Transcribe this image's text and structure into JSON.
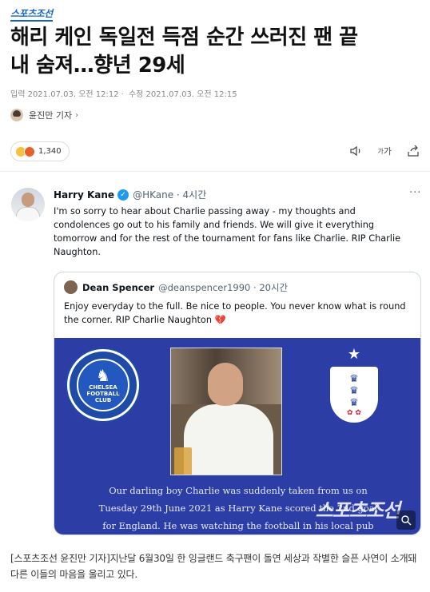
{
  "brand": {
    "logo_text": "스포츠조선"
  },
  "article": {
    "title_line1": "해리 케인 독일전 득점 순간 쓰러진 팬 끝",
    "title_line2": "내 숨져…향년 29세",
    "published": "입력 2021.07.03. 오전 12:12",
    "modified": "수정 2021.07.03. 오전 12:15",
    "reporter": "윤진만 기자",
    "reaction_count": "1,340",
    "caption": "[스포츠조선 윤진만 기자]지난달 6월30일 한 잉글랜드 축구팬이 돌연 세상과 작별한 슬픈 사연이 소개돼 다른 이들의 마음을 울리고 있다."
  },
  "toolbar": {
    "font_size_label": "가"
  },
  "tweet": {
    "name": "Harry Kane",
    "handle": "@HKane · 4시간",
    "more": "···",
    "text": "I'm so sorry to hear about Charlie passing away - my thoughts and condolences go out to his family and friends. We will give it everything tomorrow and for the rest of the tournament for fans like Charlie. RIP Charlie Naughton.",
    "quote": {
      "name": "Dean Spencer",
      "handle": "@deanspencer1990 · 20시간",
      "text": "Enjoy everyday to the full. Be nice to people. You never know what is round the corner. RIP Charlie Naughton",
      "heart": "💔",
      "image": {
        "chelsea_badge_text": "CHELSEA FOOTBALL CLUB",
        "image_text_lines": [
          "Our darling boy Charlie was suddenly taken from us on",
          "Tuesday 29th June 2021 as Harry Kane scored the 2nd goal",
          "for England. He was watching the football in his local pub"
        ],
        "watermark": "스포츠조선"
      }
    }
  },
  "colors": {
    "brand_blue": "#1566c0",
    "twitter_blue": "#1d9bf0",
    "quote_image_bg": "#2c3ea6"
  }
}
